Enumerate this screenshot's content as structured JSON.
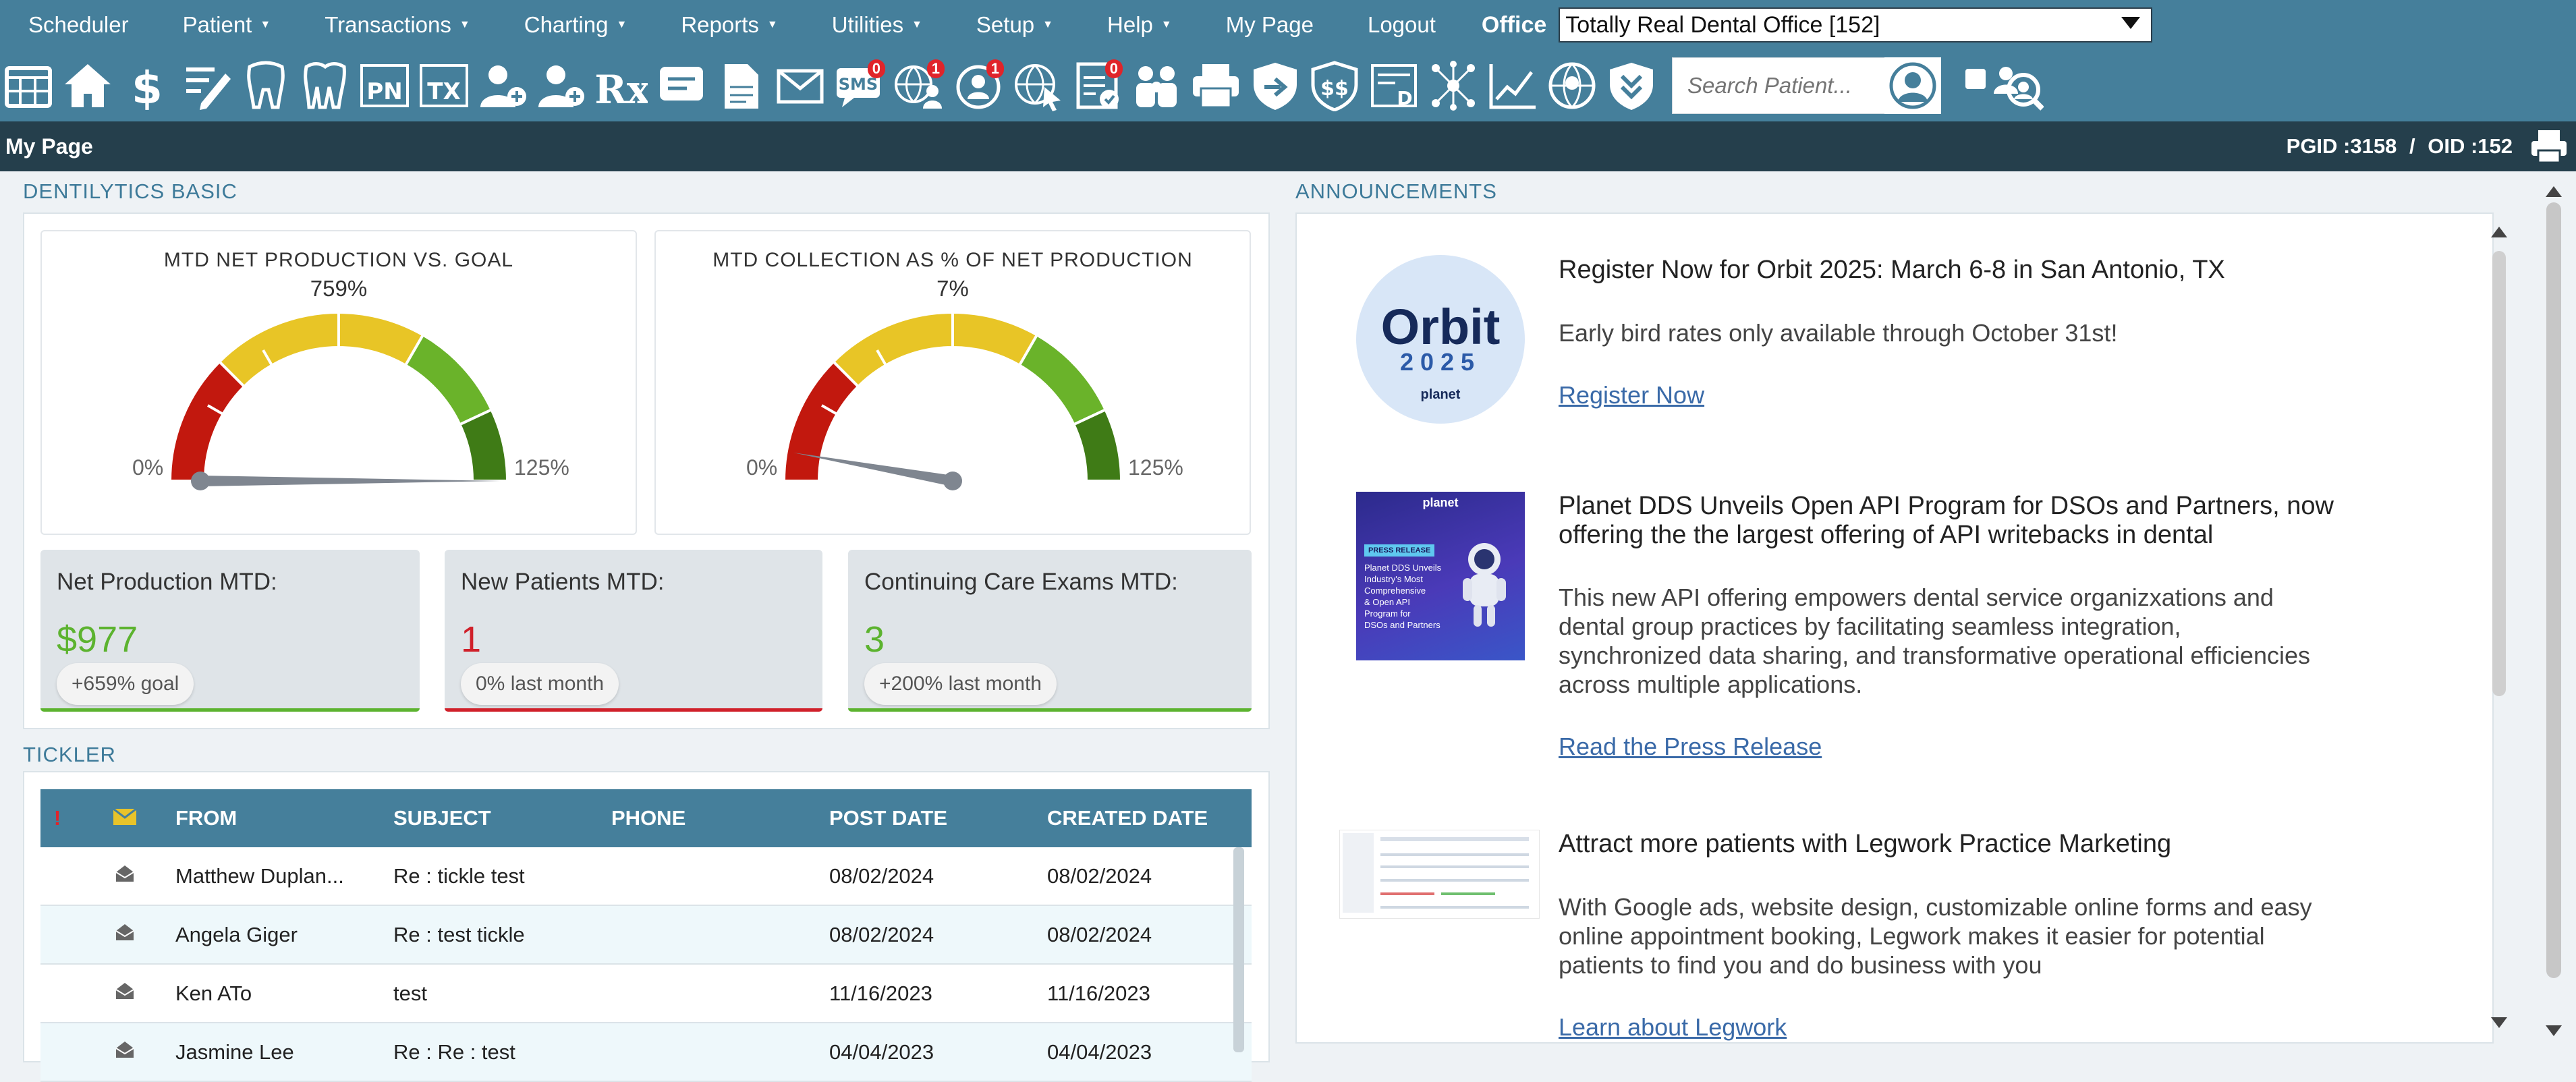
{
  "menu": {
    "items": [
      {
        "label": "Scheduler",
        "caret": false
      },
      {
        "label": "Patient",
        "caret": true
      },
      {
        "label": "Transactions",
        "caret": true
      },
      {
        "label": "Charting",
        "caret": true
      },
      {
        "label": "Reports",
        "caret": true
      },
      {
        "label": "Utilities",
        "caret": true
      },
      {
        "label": "Setup",
        "caret": true
      },
      {
        "label": "Help",
        "caret": true
      },
      {
        "label": "My Page",
        "caret": false
      },
      {
        "label": "Logout",
        "caret": false
      }
    ],
    "office_label": "Office",
    "office_value": "Totally Real Dental Office [152]"
  },
  "toolbar": {
    "icons": [
      "calendar-icon",
      "home-icon",
      "dollar-icon",
      "notes-edit-icon",
      "tooth-icon",
      "teeth-icon",
      "pn-icon",
      "tx-icon",
      "add-patient-icon",
      "add-family-icon",
      "rx-icon",
      "message-icon",
      "document-icon",
      "email-icon",
      "sms-icon",
      "globe-user-icon",
      "chat-user-icon",
      "globe-cursor-icon",
      "checklist-icon",
      "family-icon",
      "printer-icon",
      "forward-shield-icon",
      "money-shield-icon",
      "report-d-icon",
      "network-icon",
      "line-chart-icon",
      "globe-user-circle-icon",
      "chevron-shield-icon"
    ],
    "badges": {
      "sms-icon": "0",
      "globe-user-icon": "1",
      "chat-user-icon": "1",
      "checklist-icon": "0"
    },
    "search_placeholder": "Search Patient..."
  },
  "page": {
    "title": "My Page",
    "pgid_label": "PGID :3158",
    "separator": "/",
    "oid_label": "OID :152"
  },
  "dentilytics": {
    "section_title": "DENTILYTICS BASIC",
    "gauges": [
      {
        "title": "MTD NET PRODUCTION VS. GOAL",
        "value_label": "759%",
        "value_pct": 759,
        "min_label": "0%",
        "max_label": "125%"
      },
      {
        "title": "MTD COLLECTION AS % OF NET PRODUCTION",
        "value_label": "7%",
        "value_pct": 7,
        "min_label": "0%",
        "max_label": "125%"
      }
    ],
    "stats": [
      {
        "label": "Net Production MTD:",
        "value": "$977",
        "pill": "+659% goal",
        "color": "#5cb32f"
      },
      {
        "label": "New Patients MTD:",
        "value": "1",
        "pill": "0% last month",
        "color": "#d0202a"
      },
      {
        "label": "Continuing Care Exams MTD:",
        "value": "3",
        "pill": "+200% last month",
        "color": "#5cb32f"
      }
    ]
  },
  "tickler": {
    "section_title": "TICKLER",
    "headers": {
      "priority": "!",
      "from": "FROM",
      "subject": "SUBJECT",
      "phone": "PHONE",
      "post_date": "POST DATE",
      "created_date": "CREATED DATE"
    },
    "rows": [
      {
        "from": "Matthew Duplan...",
        "subject": "Re : tickle test",
        "phone": "",
        "post_date": "08/02/2024",
        "created_date": "08/02/2024"
      },
      {
        "from": "Angela Giger",
        "subject": "Re : test tickle",
        "phone": "",
        "post_date": "08/02/2024",
        "created_date": "08/02/2024"
      },
      {
        "from": "Ken ATo",
        "subject": "test",
        "phone": "",
        "post_date": "11/16/2023",
        "created_date": "11/16/2023"
      },
      {
        "from": "Jasmine Lee",
        "subject": "Re : Re : test",
        "phone": "",
        "post_date": "04/04/2023",
        "created_date": "04/04/2023"
      }
    ]
  },
  "announcements": {
    "section_title": "ANNOUNCEMENTS",
    "items": [
      {
        "title": "Register Now for Orbit 2025: March 6-8 in San Antonio, TX",
        "body": "Early bird rates only available through October 31st!",
        "link": "Register Now",
        "logo_text": "Orbit",
        "logo_year": "2025",
        "logo_brand": "planet"
      },
      {
        "title_line1": "Planet DDS Unveils Open API Program for DSOs and Partners, now",
        "title_line2": "offering the the largest offering of API writebacks in dental",
        "body_lines": [
          "This new API offering empowers dental service organizxations and",
          "dental group practices by facilitating seamless integration,",
          "synchronized data sharing, and transformative operational efficiencies",
          "across multiple applications."
        ],
        "link": "Read the Press Release",
        "img_brand": "planet",
        "img_tag": "PRESS RELEASE",
        "img_lines": [
          "Planet DDS Unveils",
          "Industry's Most",
          "Comprehensive",
          "& Open API",
          "Program for",
          "DSOs and Partners"
        ]
      },
      {
        "title": "Attract more patients with Legwork Practice Marketing",
        "body_lines": [
          "With Google ads, website design, customizable online forms and easy",
          "online appointment booking, Legwork makes it easier for potential",
          "patients to find you and do business with you"
        ],
        "link": "Learn about Legwork"
      }
    ]
  }
}
